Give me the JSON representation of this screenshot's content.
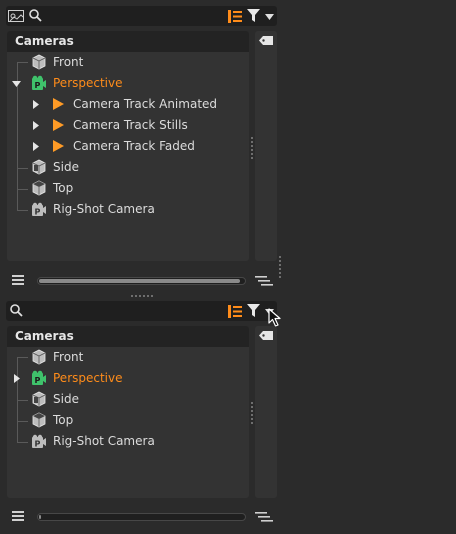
{
  "colors": {
    "accent_orange": "#ff8c1a",
    "perspective_green": "#3fc26b",
    "panel_bg": "#333333",
    "header_bg": "#232323",
    "window_bg": "#2b2b2b"
  },
  "top_panel": {
    "search": {
      "value": "",
      "placeholder": ""
    },
    "icons": [
      "viewport-icon",
      "search-icon",
      "hierarchy-icon",
      "filter-icon",
      "chevron-down-icon"
    ],
    "header_title": "Cameras",
    "items": [
      {
        "label": "Front",
        "icon": "camera-cube-icon",
        "expander": "none"
      },
      {
        "label": "Perspective",
        "icon": "perspective-camera-icon",
        "expander": "expanded",
        "active": true
      },
      {
        "label": "Camera Track Animated",
        "icon": "track-play-icon",
        "expander": "collapsed"
      },
      {
        "label": "Camera Track Stills",
        "icon": "track-play-icon",
        "expander": "collapsed"
      },
      {
        "label": "Camera Track Faded",
        "icon": "track-play-icon",
        "expander": "collapsed"
      },
      {
        "label": "Side",
        "icon": "camera-cube-icon",
        "expander": "none"
      },
      {
        "label": "Top",
        "icon": "camera-cube-icon",
        "expander": "none"
      },
      {
        "label": "Rig-Shot Camera",
        "icon": "rig-camera-icon",
        "expander": "none"
      }
    ],
    "hscroll_fraction": 0.98
  },
  "bottom_panel": {
    "search": {
      "value": "",
      "placeholder": ""
    },
    "icons": [
      "search-icon",
      "hierarchy-icon",
      "filter-icon",
      "chevron-down-icon"
    ],
    "header_title": "Cameras",
    "items": [
      {
        "label": "Front",
        "icon": "camera-cube-icon",
        "expander": "none"
      },
      {
        "label": "Perspective",
        "icon": "perspective-camera-icon",
        "expander": "collapsed",
        "active": true
      },
      {
        "label": "Side",
        "icon": "camera-cube-icon",
        "expander": "none"
      },
      {
        "label": "Top",
        "icon": "camera-cube-icon",
        "expander": "none"
      },
      {
        "label": "Rig-Shot Camera",
        "icon": "rig-camera-icon",
        "expander": "none"
      }
    ],
    "hscroll_fraction": 0.01
  }
}
